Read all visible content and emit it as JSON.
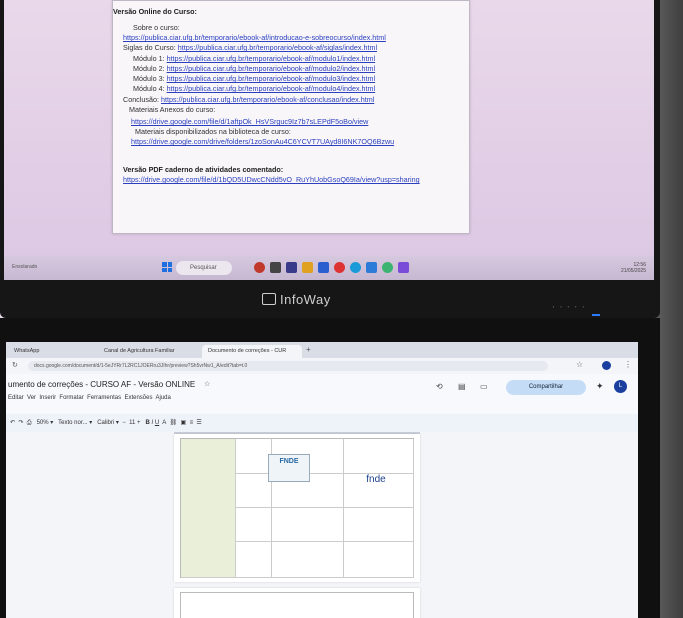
{
  "top_doc": {
    "heading": "Versão Online do Curso:",
    "lines": [
      {
        "label": "Sobre o curso:",
        "link": ""
      },
      {
        "label": "",
        "link": "https://publica.ciar.ufg.br/temporario/ebook-af/introducao-e-sobreocurso/index.html"
      },
      {
        "label": "Siglas do Curso: ",
        "link": "https://publica.ciar.ufg.br/temporario/ebook-af/siglas/index.html"
      },
      {
        "label": "Módulo 1: ",
        "link": "https://publica.ciar.ufg.br/temporario/ebook-af/modulo1/index.html"
      },
      {
        "label": "Módulo 2: ",
        "link": "https://publica.ciar.ufg.br/temporario/ebook-af/modulo2/index.html"
      },
      {
        "label": "Módulo 3: ",
        "link": "https://publica.ciar.ufg.br/temporario/ebook-af/modulo3/index.html"
      },
      {
        "label": "Módulo 4: ",
        "link": "https://publica.ciar.ufg.br/temporario/ebook-af/modulo4/index.html"
      },
      {
        "label": "Conclusão: ",
        "link": "https://publica.ciar.ufg.br/temporario/ebook-af/conclusao/index.html"
      },
      {
        "label": "Materiais Anexos do curso:",
        "link": ""
      },
      {
        "label": "",
        "link": "https://drive.google.com/file/d/1aftpOk_HsVSrguc9Iz7b7sLEPdF5oBo/view"
      },
      {
        "label": "Materiais disponibilizados na biblioteca de curso:",
        "link": ""
      },
      {
        "label": "",
        "link": "https://drive.google.com/drive/folders/1zoSonAu4C6YCVT7UAyd8I6NK7OQ6Bzwu"
      }
    ],
    "pdf_heading": "Versão PDF caderno de atividades comentado:",
    "pdf_link": "https://drive.google.com/file/d/1bQD5UDwcCNdd5vO_RuYhUobGsoQ69Ia/view?usp=sharing"
  },
  "taskbar": {
    "search": "Pesquisar",
    "left_text": "Ensolarado",
    "clock_time": "12:56",
    "clock_date": "21/05/2025"
  },
  "monitor_brand": "InfoWay",
  "browser": {
    "tabs": [
      "WhatsApp",
      "Canal de Agricultura Familiar",
      "Documento de correções - CUR"
    ],
    "url": "docs.google.com/document/d/1-5eJYRr7L2RC1JOERru3JIhr/preview?Sh5vrNw1_A/edit?tab=t.0",
    "bookmarks_label": "Todos os favoritos"
  },
  "gdocs": {
    "title": "umento de correções - CURSO AF - Versão ONLINE",
    "menu": [
      "Editar",
      "Ver",
      "Inserir",
      "Formatar",
      "Ferramentas",
      "Extensões",
      "Ajuda"
    ],
    "share_label": "Compartilhar",
    "avatar_letter": "L",
    "zoom": "50%",
    "style": "Texto nor...",
    "font": "Calibri",
    "font_size": "11"
  },
  "embedded_logos": {
    "fnde_small": "FNDE",
    "fnde_large": "fnde"
  }
}
